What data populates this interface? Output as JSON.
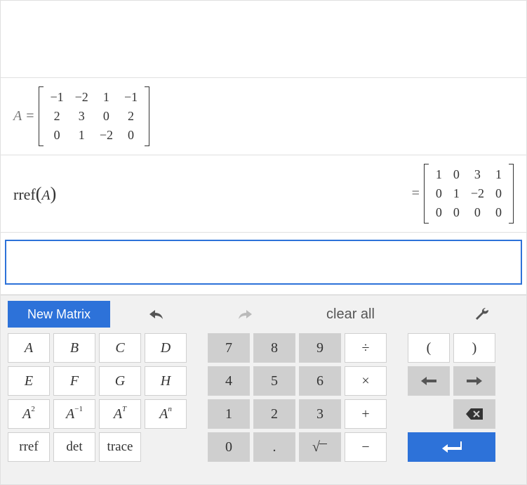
{
  "history": {
    "def": {
      "var": "A",
      "matrix": [
        [
          "−1",
          "−2",
          "1",
          "−1"
        ],
        [
          "2",
          "3",
          "0",
          "2"
        ],
        [
          "0",
          "1",
          "−2",
          "0"
        ]
      ]
    },
    "expr": {
      "fn": "rref",
      "arg": "A",
      "result": [
        [
          "1",
          "0",
          "3",
          "1"
        ],
        [
          "0",
          "1",
          "−2",
          "0"
        ],
        [
          "0",
          "0",
          "0",
          "0"
        ]
      ]
    }
  },
  "toolbar": {
    "new_matrix": "New Matrix",
    "clear_all": "clear all"
  },
  "keys": {
    "vars": [
      "A",
      "B",
      "C",
      "D",
      "E",
      "F",
      "G",
      "H"
    ],
    "sq": "A",
    "sq_sup": "2",
    "inv": "A",
    "inv_sup": "−1",
    "trans": "A",
    "trans_sup": "T",
    "pow": "A",
    "pow_sup": "n",
    "rref": "rref",
    "det": "det",
    "trace": "trace",
    "nums": [
      "7",
      "8",
      "9",
      "4",
      "5",
      "6",
      "1",
      "2",
      "3",
      "0",
      "."
    ],
    "sqrt": "√",
    "div": "÷",
    "mul": "×",
    "add": "+",
    "sub": "−",
    "lp": "(",
    "rp": ")",
    "left": "←",
    "right": "→"
  },
  "chart_data": {
    "type": "table",
    "title": "Matrix A and rref(A)",
    "matrices": {
      "A": [
        [
          -1,
          -2,
          1,
          -1
        ],
        [
          2,
          3,
          0,
          2
        ],
        [
          0,
          1,
          -2,
          0
        ]
      ],
      "rref_A": [
        [
          1,
          0,
          3,
          1
        ],
        [
          0,
          1,
          -2,
          0
        ],
        [
          0,
          0,
          0,
          0
        ]
      ]
    }
  }
}
